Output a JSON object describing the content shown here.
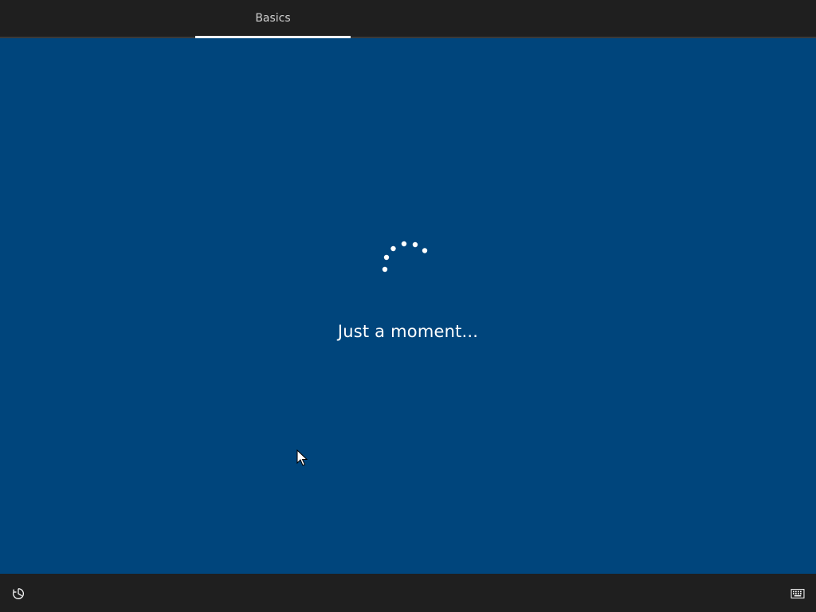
{
  "header": {
    "tabs": [
      {
        "label": "Basics",
        "active": true
      }
    ]
  },
  "main": {
    "status_text": "Just a moment...",
    "spinner_icon": "loading-dots-icon"
  },
  "footer": {
    "left_icon": "ease-of-access-icon",
    "right_icon": "keyboard-icon"
  },
  "colors": {
    "background": "#00457c",
    "bars": "#1f1f1f",
    "tab_text": "#d0d0d0",
    "accent": "#ffffff"
  }
}
